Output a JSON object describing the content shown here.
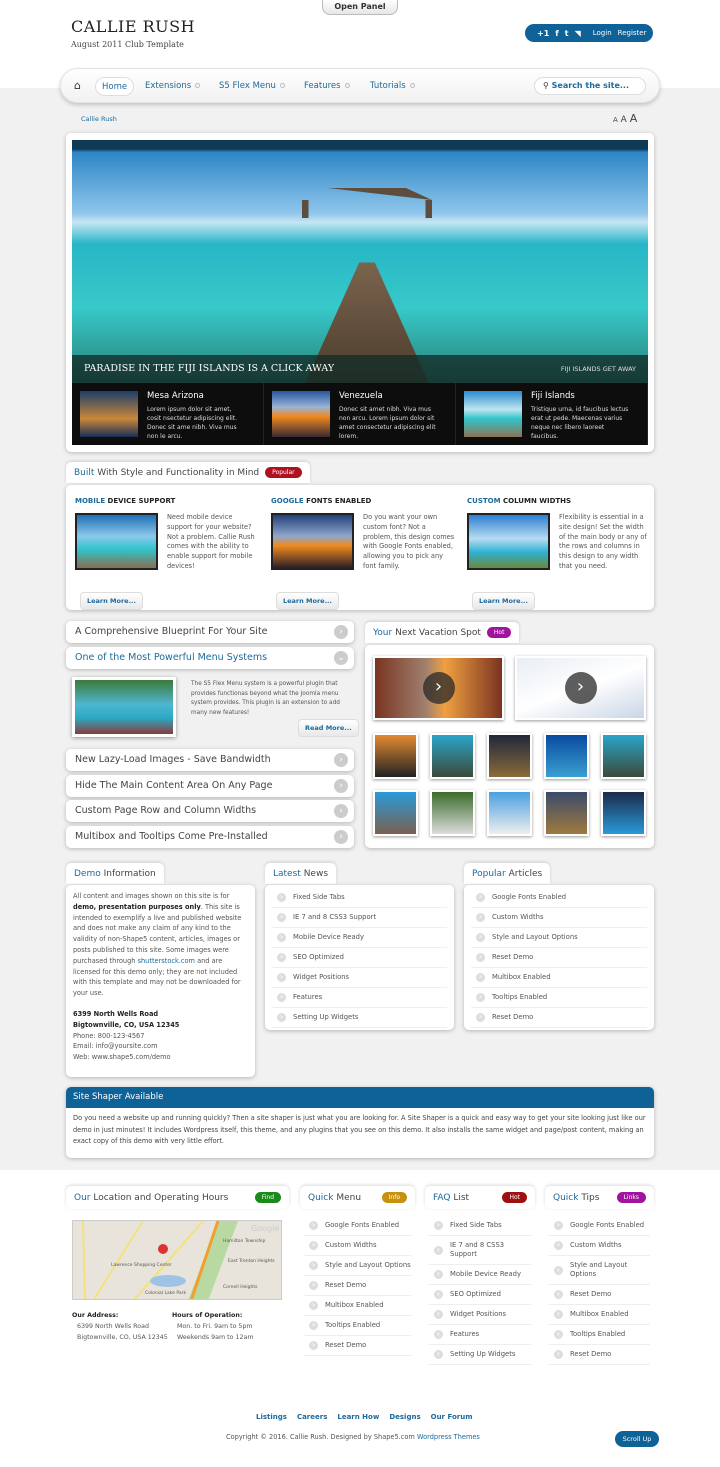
{
  "header": {
    "open_panel": "Open Panel",
    "logo": "CALLIE RUSH",
    "tagline": "August 2011 Club Template",
    "social": [
      "+1",
      "f",
      "t",
      "rss"
    ],
    "login": "Login",
    "register": "Register"
  },
  "nav": {
    "items": [
      "Home",
      "Extensions",
      "S5 Flex Menu",
      "Features",
      "Tutorials"
    ],
    "search_placeholder": "Search the site..."
  },
  "breadcrumb": "Callie Rush",
  "font_sizer": [
    "A",
    "A",
    "A"
  ],
  "slideshow": {
    "caption": "PARADISE IN THE FIJI ISLANDS IS A CLICK AWAY",
    "caption_right": "FIJI ISLANDS GET AWAY",
    "thumbs": [
      {
        "title": "Mesa Arizona",
        "text": "Lorem ipsum dolor sit amet, cosit nsectetur adipiscing elit. Donec sit ame nibh. Viva mus non le arcu."
      },
      {
        "title": "Venezuela",
        "text": "Donec sit amet nibh. Viva mus non arcu. Lorem ipsum dolor sit amet consectetur adipiscing elit lorem."
      },
      {
        "title": "Fiji Islands",
        "text": "Tristique urna, id faucibus lectus erat ut pede. Maecenas varius neque nec libero laoreet faucibus."
      }
    ]
  },
  "built": {
    "title_blue": "Built",
    "title": "With Style and Functionality in Mind",
    "badge": "Popular",
    "badge_color": "#b01020",
    "features": [
      {
        "h_blue": "MOBILE",
        "h": "DEVICE SUPPORT",
        "text": "Need mobile device support for your website? Not a problem. Callie Rush comes with the ability to enable support for mobile devices!",
        "button": "Learn More..."
      },
      {
        "h_blue": "GOOGLE",
        "h": "FONTS ENABLED",
        "text": "Do you want your own custom font? Not a problem, this design comes with Google Fonts enabled, allowing you to pick any font family.",
        "button": "Learn More..."
      },
      {
        "h_blue": "CUSTOM",
        "h": "COLUMN WIDTHS",
        "text": "Flexibility is essential in a site design! Set the width of the main body or any of the rows and columns in this design to any width that you need.",
        "button": "Learn More..."
      }
    ]
  },
  "accordion": {
    "items": [
      "A Comprehensive Blueprint For Your Site",
      "One of the Most Powerful Menu Systems",
      "New Lazy-Load Images - Save Bandwidth",
      "Hide The Main Content Area On Any Page",
      "Custom Page Row and Column Widths",
      "Multibox and Tooltips Come Pre-Installed"
    ],
    "open_text": "The S5 Flex Menu system is a powerful plugin that provides functionas beyond what the Joomla menu system provides. This plugin is an extension to add many new features!",
    "read_more": "Read More..."
  },
  "vacation": {
    "title_blue": "Your",
    "title": "Next Vacation Spot",
    "badge": "Hot",
    "badge_color": "#a0139c"
  },
  "demo": {
    "title_blue": "Demo",
    "title": "Information",
    "p1": "All content and images shown on this site is for ",
    "p1_bold": "demo, presentation purposes only",
    "p2": ". This site is intended to exemplify a live and published website and does not make any claim of any kind to the validity of non-Shape5 content, articles, images or posts published to this site. Some images were purchased through ",
    "link": "shutterstock.com",
    "p3": " and are licensed for this demo only; they are not included with this template and may not be downloaded for your use.",
    "addr1": "6399 North Wells Road",
    "addr2": "Bigtownville, CO, USA 12345",
    "phone": "Phone: 800-123-4567",
    "email": "Email: info@yoursite.com",
    "web": "Web: www.shape5.com/demo"
  },
  "latest": {
    "title_blue": "Latest",
    "title": "News",
    "items": [
      "Fixed Side Tabs",
      "IE 7 and 8 CSS3 Support",
      "Mobile Device Ready",
      "SEO Optimized",
      "Widget Positions",
      "Features",
      "Setting Up Widgets"
    ]
  },
  "popular": {
    "title_blue": "Popular",
    "title": "Articles",
    "items": [
      "Google Fonts Enabled",
      "Custom Widths",
      "Style and Layout Options",
      "Reset Demo",
      "Multibox Enabled",
      "Tooltips Enabled",
      "Reset Demo"
    ]
  },
  "shaper": {
    "title": "Site Shaper Available",
    "text": "Do you need a website up and running quickly? Then a site shaper is just what you are looking for. A Site Shaper is a quick and easy way to get your site looking just like our demo in just minutes! It includes Wordpress itself, this theme, and any plugins that you see on this demo. It also installs the same widget and page/post content, making an exact copy of this demo with very little effort."
  },
  "location": {
    "title_blue": "Our",
    "title": "Location and Operating Hours",
    "badge": "Find",
    "badge_color": "#1a8a1a",
    "addr_label": "Our Address:",
    "addr1": "6399 North Wells Road",
    "addr2": "Bigtownville, CO, USA 12345",
    "hours_label": "Hours of Operation:",
    "hours1": "Mon. to Fri. 9am to 5pm",
    "hours2": "Weekends 9am to 12am",
    "map_labels": [
      "Lawrence Shopping Center",
      "East Trenton Heights",
      "Colonial Lake Park",
      "Hamilton Township",
      "Cornell Heights",
      "Google"
    ]
  },
  "quickmenu": {
    "title_blue": "Quick",
    "title": "Menu",
    "badge": "Info",
    "badge_color": "#c8900f",
    "items": [
      "Google Fonts Enabled",
      "Custom Widths",
      "Style and Layout Options",
      "Reset Demo",
      "Multibox Enabled",
      "Tooltips Enabled",
      "Reset Demo"
    ]
  },
  "faq": {
    "title_blue": "FAQ",
    "title": "List",
    "badge": "Hot",
    "badge_color": "#a01010",
    "items": [
      "Fixed Side Tabs",
      "IE 7 and 8 CSS3 Support",
      "Mobile Device Ready",
      "SEO Optimized",
      "Widget Positions",
      "Features",
      "Setting Up Widgets"
    ]
  },
  "quicktips": {
    "title_blue": "Quick",
    "title": "Tips",
    "badge": "Links",
    "badge_color": "#a0139c",
    "items": [
      "Google Fonts Enabled",
      "Custom Widths",
      "Style and Layout Options",
      "Reset Demo",
      "Multibox Enabled",
      "Tooltips Enabled",
      "Reset Demo"
    ]
  },
  "footer": {
    "links": [
      "Listings",
      "Careers",
      "Learn How",
      "Designs",
      "Our Forum"
    ],
    "copyright": "Copyright © 2016. Callie Rush. Designed by Shape5.com ",
    "copyright_link": "Wordpress Themes",
    "scroll_up": "Scroll Up"
  }
}
